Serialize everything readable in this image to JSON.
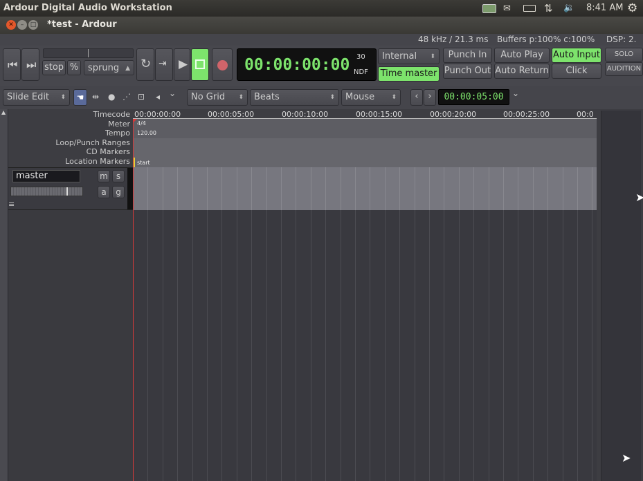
{
  "system_bar": {
    "title": "Ardour Digital Audio Workstation",
    "clock": "8:41 AM",
    "icons": [
      "keyboard-icon",
      "mail-icon",
      "battery-icon",
      "network-icon",
      "volume-icon",
      "gear-icon"
    ]
  },
  "window": {
    "title": "*test - Ardour"
  },
  "status": {
    "sample_rate": "48 kHz / 21.3 ms",
    "buffers": "Buffers p:100% c:100%",
    "dsp": "DSP:  2."
  },
  "transport": {
    "stop_label": "stop",
    "percent_label": "%",
    "sprung_label": "sprung",
    "clock_time": "00:00:00:00",
    "clock_fps": "30",
    "clock_ndf": "NDF",
    "sync_source": "Internal",
    "time_master": "Time master",
    "punch_in": "Punch In",
    "punch_out": "Punch Out",
    "auto_play": "Auto Play",
    "auto_return": "Auto Return",
    "auto_input": "Auto Input",
    "click": "Click",
    "solo": "SOLO",
    "audition": "AUDITION"
  },
  "edit_toolbar": {
    "edit_mode": "Slide Edit",
    "grid": "No Grid",
    "grid_unit": "Beats",
    "edit_point": "Mouse",
    "nudge_clock": "00:00:05:00"
  },
  "rulers": {
    "labels": [
      "Timecode",
      "Meter",
      "Tempo",
      "Loop/Punch Ranges",
      "CD Markers",
      "Location Markers"
    ],
    "timecode_ticks": [
      "00:00:00:00",
      "00:00:05:00",
      "00:00:10:00",
      "00:00:15:00",
      "00:00:20:00",
      "00:00:25:00",
      "00:0"
    ],
    "meter_value": "4/4",
    "tempo_value": "120.00",
    "location_marker": "start"
  },
  "tracks": [
    {
      "name": "master",
      "buttons": {
        "mute": "m",
        "solo": "s",
        "automation": "a",
        "group": "g"
      }
    }
  ],
  "colors": {
    "accent_green": "#7de36c",
    "playhead": "#d33a3a"
  }
}
